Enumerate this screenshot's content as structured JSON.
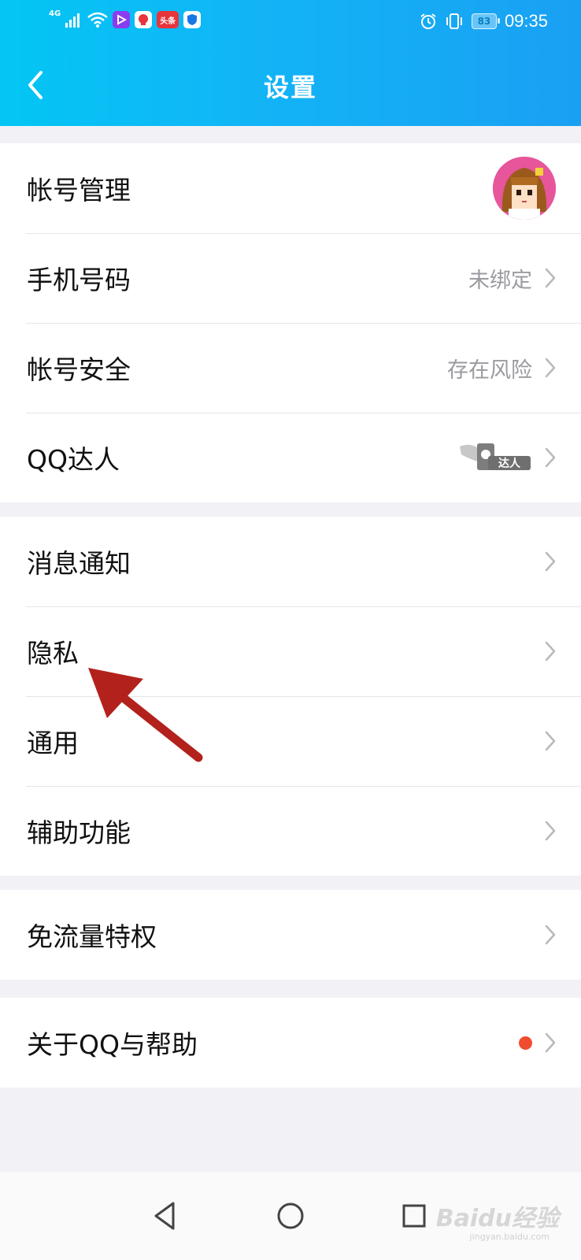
{
  "status_bar": {
    "network": "4G",
    "app_icons": [
      "video-app-icon",
      "qq-icon",
      "toutiao-icon",
      "shield-app-icon"
    ],
    "toutiao_label": "头条",
    "battery_level": "83",
    "time": "09:35"
  },
  "header": {
    "title": "设置"
  },
  "groups": [
    {
      "rows": [
        {
          "label": "帐号管理",
          "value": "",
          "right": "avatar"
        },
        {
          "label": "手机号码",
          "value": "未绑定"
        },
        {
          "label": "帐号安全",
          "value": "存在风险"
        },
        {
          "label": "QQ达人",
          "value": "",
          "badge": "达人"
        }
      ]
    },
    {
      "rows": [
        {
          "label": "消息通知"
        },
        {
          "label": "隐私"
        },
        {
          "label": "通用"
        },
        {
          "label": "辅助功能"
        }
      ]
    },
    {
      "rows": [
        {
          "label": "免流量特权"
        }
      ]
    },
    {
      "rows": [
        {
          "label": "关于QQ与帮助",
          "indicator": "red-dot"
        }
      ]
    }
  ],
  "annotation": {
    "type": "red-arrow",
    "color": "#b3211c",
    "points_to": "隐私"
  },
  "nav_bar": {
    "buttons": [
      "back-triangle",
      "home-circle",
      "recents-square"
    ]
  },
  "watermark": {
    "text": "Baidu经验",
    "sub": "jingyan.baidu.com"
  },
  "colors": {
    "header_start": "#03c6f4",
    "header_end": "#1aa0f3",
    "page_bg": "#f1f1f6",
    "secondary_text": "#9a9a9f",
    "red_dot": "#f24c30"
  }
}
